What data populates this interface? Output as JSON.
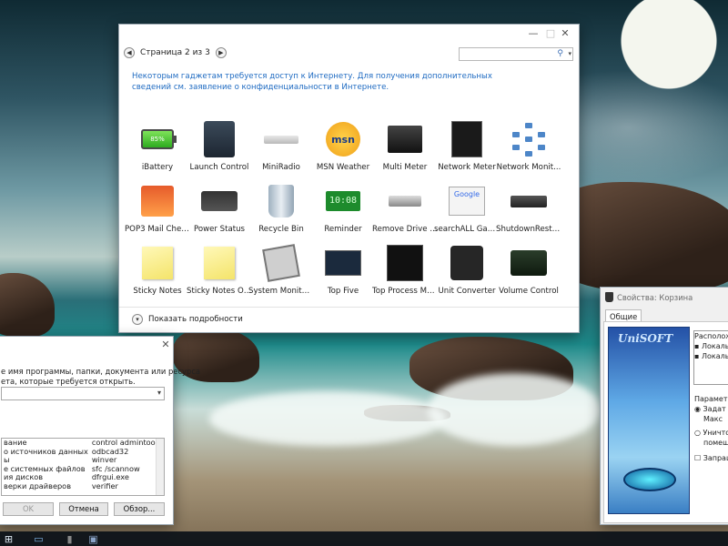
{
  "gallery": {
    "page_label": "Страница 2 из 3",
    "search_placeholder": "",
    "notice": "Некоторым гаджетам требуется доступ к Интернету. Для получения дополнительных сведений см. заявление о конфиденциальности в Интернете.",
    "details_label": "Показать подробности",
    "gadgets": [
      {
        "name": "iBattery",
        "icon": "battery-icon",
        "extra": "85%"
      },
      {
        "name": "Launch Control",
        "icon": "launch-control-icon"
      },
      {
        "name": "MiniRadio",
        "icon": "radio-icon"
      },
      {
        "name": "MSN Weather",
        "icon": "msn-weather-icon",
        "extra": "msn"
      },
      {
        "name": "Multi Meter",
        "icon": "multi-meter-icon"
      },
      {
        "name": "Network Meter",
        "icon": "network-meter-icon"
      },
      {
        "name": "Network Monit...",
        "icon": "network-monitor-icon"
      },
      {
        "name": "POP3 Mail Chec...",
        "icon": "mail-icon"
      },
      {
        "name": "Power Status",
        "icon": "power-status-icon"
      },
      {
        "name": "Recycle Bin",
        "icon": "recycle-bin-icon"
      },
      {
        "name": "Reminder",
        "icon": "reminder-icon",
        "extra": "10:08"
      },
      {
        "name": "Remove Drive S...",
        "icon": "usb-drive-icon"
      },
      {
        "name": "searchALL Gadg...",
        "icon": "google-search-icon",
        "extra": "Google"
      },
      {
        "name": "ShutdownRestart",
        "icon": "shutdown-icon"
      },
      {
        "name": "Sticky Notes",
        "icon": "sticky-note-icon"
      },
      {
        "name": "Sticky Notes On...",
        "icon": "sticky-note-icon"
      },
      {
        "name": "System Monitor II",
        "icon": "cpu-icon"
      },
      {
        "name": "Top Five",
        "icon": "top-five-icon"
      },
      {
        "name": "Top Process Mo...",
        "icon": "top-process-icon"
      },
      {
        "name": "Unit Converter",
        "icon": "unit-converter-icon"
      },
      {
        "name": "Volume Control",
        "icon": "volume-icon"
      }
    ]
  },
  "run_dialog": {
    "prompt": "е имя программы, папки, документа или ресурса\nета, которые требуется открыть.",
    "rows": [
      {
        "name": "вание",
        "cmd": "control admintools"
      },
      {
        "name": "о источников данных",
        "cmd": "odbcad32"
      },
      {
        "name": "ы",
        "cmd": "winver"
      },
      {
        "name": "е системных файлов",
        "cmd": "sfc /scannow"
      },
      {
        "name": "ия дисков",
        "cmd": "dfrgui.exe"
      },
      {
        "name": "верки драйверов",
        "cmd": "verifier"
      }
    ],
    "ok_label": "OK",
    "cancel_label": "Отмена",
    "browse_label": "Обзор..."
  },
  "properties": {
    "title": "Свойства: Корзина",
    "tab": "Общие",
    "logo_text": "UniSOFT",
    "location_header": "Располож",
    "locations": [
      "Локальн",
      "Локальн"
    ],
    "params_header": "Параметры",
    "opt1": "Задат",
    "opt1b": "Макс",
    "opt2": "Уничто",
    "opt2b": "помеща",
    "confirm": "Запраш"
  },
  "colors": {
    "link": "#1f6bc2"
  }
}
